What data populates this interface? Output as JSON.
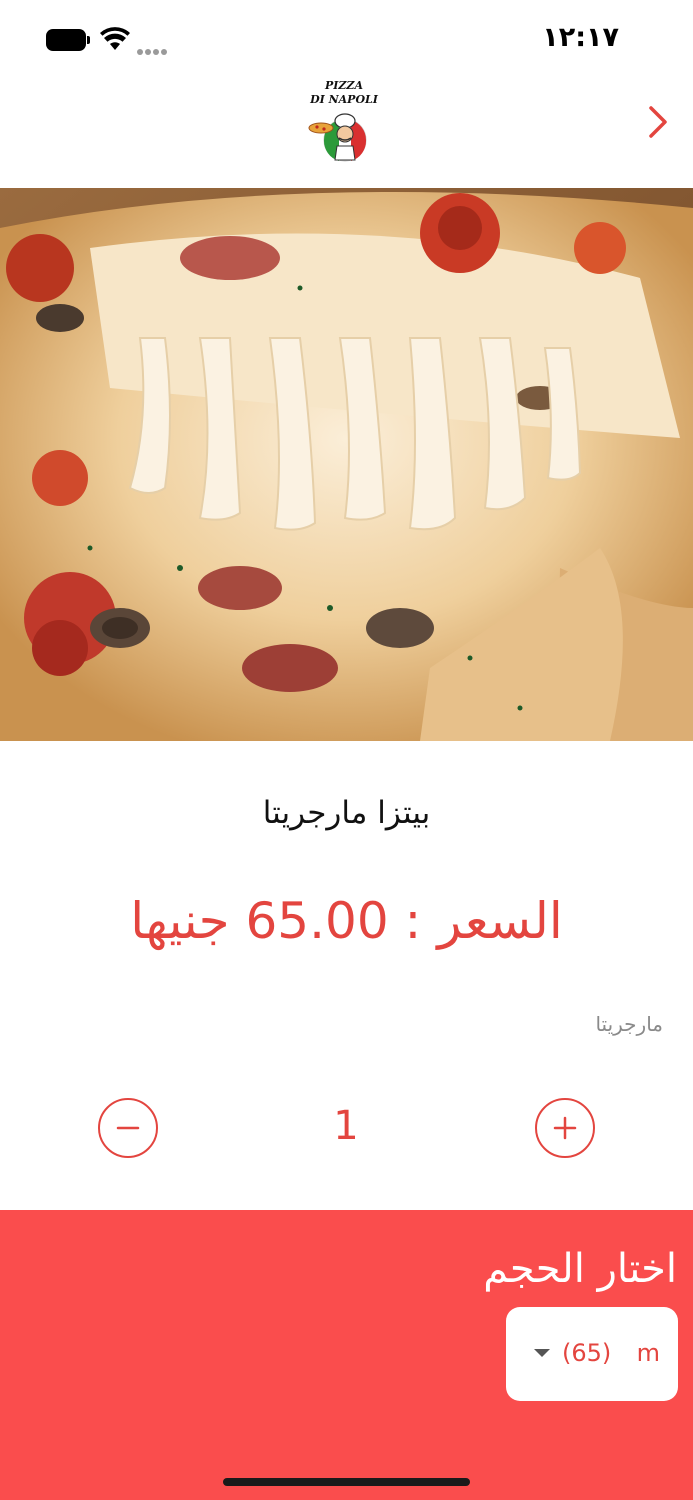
{
  "status_bar": {
    "time": "١٢:١٧"
  },
  "header": {
    "logo_line1": "PIZZA",
    "logo_line2": "DI NAPOLI",
    "back_icon": "chevron-right-icon"
  },
  "product": {
    "image_icon": "pizza-photo",
    "name": "بيتزا مارجريتا",
    "price_label": "السعر",
    "price_separator": ":",
    "price_value": "65.00",
    "currency": "جنيها",
    "description": "مارجريتا"
  },
  "quantity": {
    "value": "1",
    "minus_icon": "minus-icon",
    "plus_icon": "plus-icon"
  },
  "size": {
    "title": "اختار الحجم",
    "selected_label": "m",
    "selected_price": "(65)",
    "dropdown_icon": "caret-down-icon"
  },
  "colors": {
    "accent": "#e3453f",
    "panel": "#fa4d4d",
    "text": "#111111",
    "muted": "#8a8a8a"
  }
}
